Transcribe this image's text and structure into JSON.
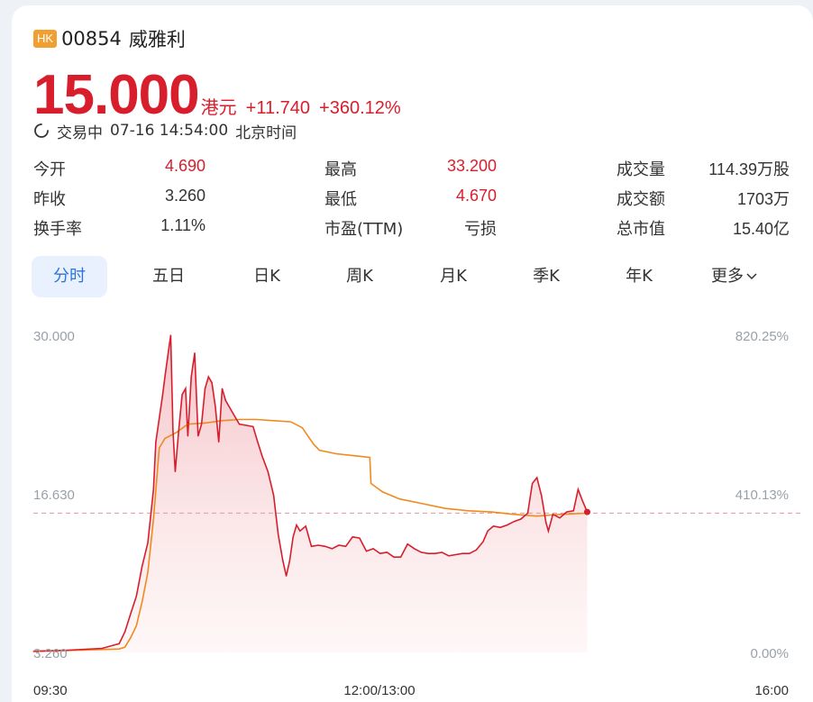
{
  "header": {
    "badge": "HK",
    "code": "00854",
    "name": "威雅利"
  },
  "quote": {
    "price": "15.000",
    "unit": "港元",
    "change": "+11.740",
    "change_pct": "+360.12%"
  },
  "status": {
    "state": "交易中",
    "datetime": "07-16 14:54:00",
    "timezone": "北京时间"
  },
  "stats": [
    {
      "label": "今开",
      "value": "4.690",
      "red": true
    },
    {
      "label": "最高",
      "value": "33.200",
      "red": true
    },
    {
      "label": "成交量",
      "value": "114.39万股",
      "red": false
    },
    {
      "label": "昨收",
      "value": "3.260",
      "red": false
    },
    {
      "label": "最低",
      "value": "4.670",
      "red": true
    },
    {
      "label": "成交额",
      "value": "1703万",
      "red": false
    },
    {
      "label": "换手率",
      "value": "1.11%",
      "red": false
    },
    {
      "label": "市盈(TTM)",
      "value": "亏损",
      "red": false
    },
    {
      "label": "总市值",
      "value": "15.40亿",
      "red": false
    }
  ],
  "tabs": [
    {
      "label": "分时",
      "active": true
    },
    {
      "label": "五日",
      "active": false
    },
    {
      "label": "日K",
      "active": false
    },
    {
      "label": "周K",
      "active": false
    },
    {
      "label": "月K",
      "active": false
    },
    {
      "label": "季K",
      "active": false
    },
    {
      "label": "年K",
      "active": false
    },
    {
      "label": "更多",
      "active": false
    }
  ],
  "colors": {
    "up": "#d81e2c",
    "avg": "#f08a1e",
    "accent": "#2f74d7"
  },
  "chart_data": {
    "type": "line",
    "y_left_ticks": [
      "30.000",
      "16.630",
      "3.260"
    ],
    "y_right_ticks": [
      "820.25%",
      "410.13%",
      "0.00%"
    ],
    "ylim": [
      3.26,
      30.0
    ],
    "x_ticks": [
      "09:30",
      "12:00/13:00",
      "16:00"
    ],
    "prev_close_ref": 15.0,
    "series": [
      {
        "role": "price",
        "points": [
          [
            0,
            3.36
          ],
          [
            30,
            3.45
          ],
          [
            60,
            3.6
          ],
          [
            75,
            4.0
          ],
          [
            80,
            5.0
          ],
          [
            85,
            6.5
          ],
          [
            90,
            8.0
          ],
          [
            95,
            10.5
          ],
          [
            100,
            12.5
          ],
          [
            105,
            17.0
          ],
          [
            107,
            21.0
          ],
          [
            110,
            23.0
          ],
          [
            113,
            25.0
          ],
          [
            115,
            26.5
          ],
          [
            118,
            28.6
          ],
          [
            120,
            30.0
          ],
          [
            122,
            22.0
          ],
          [
            124,
            18.5
          ],
          [
            127,
            22.0
          ],
          [
            130,
            25.0
          ],
          [
            133,
            25.5
          ],
          [
            135,
            21.5
          ],
          [
            138,
            26.5
          ],
          [
            141,
            28.5
          ],
          [
            144,
            21.5
          ],
          [
            147,
            22.5
          ],
          [
            150,
            25.5
          ],
          [
            153,
            26.5
          ],
          [
            156,
            26.0
          ],
          [
            159,
            24.0
          ],
          [
            162,
            21.0
          ],
          [
            165,
            25.5
          ],
          [
            168,
            24.5
          ],
          [
            171,
            24.0
          ],
          [
            174,
            23.5
          ],
          [
            180,
            22.5
          ],
          [
            186,
            22.4
          ],
          [
            192,
            22.3
          ],
          [
            196,
            21.0
          ],
          [
            200,
            19.8
          ],
          [
            205,
            18.5
          ],
          [
            210,
            16.5
          ],
          [
            214,
            13.2
          ],
          [
            218,
            11.0
          ],
          [
            221,
            9.7
          ],
          [
            224,
            11.0
          ],
          [
            227,
            13.0
          ],
          [
            230,
            14.0
          ],
          [
            233,
            13.5
          ],
          [
            238,
            13.9
          ],
          [
            243,
            12.2
          ],
          [
            249,
            12.3
          ],
          [
            255,
            12.2
          ],
          [
            261,
            12.0
          ],
          [
            267,
            12.3
          ],
          [
            273,
            12.2
          ],
          [
            279,
            13.0
          ],
          [
            285,
            12.9
          ],
          [
            291,
            11.8
          ],
          [
            297,
            12.0
          ],
          [
            303,
            11.6
          ],
          [
            309,
            11.7
          ],
          [
            315,
            11.3
          ],
          [
            321,
            11.3
          ],
          [
            327,
            12.4
          ],
          [
            333,
            12.0
          ],
          [
            339,
            11.7
          ],
          [
            345,
            11.6
          ],
          [
            351,
            11.6
          ],
          [
            357,
            11.7
          ],
          [
            363,
            11.4
          ],
          [
            369,
            11.5
          ],
          [
            375,
            11.6
          ],
          [
            381,
            11.6
          ],
          [
            387,
            11.9
          ],
          [
            393,
            12.6
          ],
          [
            397,
            13.5
          ],
          [
            402,
            13.9
          ],
          [
            408,
            13.8
          ],
          [
            414,
            14.0
          ],
          [
            420,
            14.3
          ],
          [
            426,
            14.5
          ],
          [
            432,
            15.0
          ],
          [
            436,
            17.5
          ],
          [
            440,
            18.0
          ],
          [
            444,
            16.5
          ],
          [
            448,
            14.2
          ],
          [
            450,
            13.5
          ],
          [
            454,
            14.9
          ],
          [
            460,
            14.6
          ],
          [
            466,
            15.1
          ],
          [
            472,
            15.2
          ],
          [
            476,
            17.0
          ],
          [
            480,
            16.0
          ],
          [
            484,
            15.1
          ]
        ]
      },
      {
        "role": "average",
        "points": [
          [
            0,
            3.34
          ],
          [
            40,
            3.45
          ],
          [
            75,
            3.55
          ],
          [
            80,
            3.7
          ],
          [
            85,
            4.5
          ],
          [
            90,
            5.5
          ],
          [
            95,
            7.5
          ],
          [
            100,
            10.0
          ],
          [
            105,
            14.5
          ],
          [
            110,
            20.5
          ],
          [
            115,
            21.3
          ],
          [
            125,
            21.8
          ],
          [
            135,
            22.5
          ],
          [
            150,
            22.6
          ],
          [
            165,
            22.8
          ],
          [
            180,
            22.9
          ],
          [
            195,
            22.9
          ],
          [
            210,
            22.8
          ],
          [
            225,
            22.7
          ],
          [
            235,
            22.2
          ],
          [
            240,
            21.5
          ],
          [
            245,
            20.8
          ],
          [
            250,
            20.3
          ],
          [
            265,
            20.0
          ],
          [
            285,
            19.8
          ],
          [
            294,
            19.7
          ],
          [
            295,
            17.5
          ],
          [
            305,
            16.8
          ],
          [
            320,
            16.2
          ],
          [
            340,
            15.8
          ],
          [
            360,
            15.4
          ],
          [
            380,
            15.2
          ],
          [
            400,
            15.1
          ],
          [
            420,
            14.9
          ],
          [
            440,
            14.75
          ],
          [
            460,
            14.9
          ],
          [
            484,
            15.0
          ]
        ]
      }
    ]
  }
}
